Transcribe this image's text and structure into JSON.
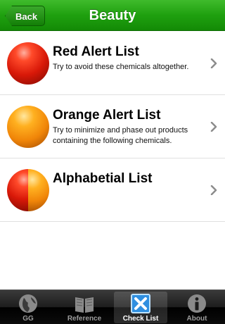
{
  "nav": {
    "back_label": "Back",
    "title": "Beauty"
  },
  "list": {
    "items": [
      {
        "title": "Red Alert List",
        "subtitle": "Try to avoid these chemicals altogether.",
        "icon": "red-ball-icon"
      },
      {
        "title": "Orange Alert List",
        "subtitle": "Try to minimize and phase out products containing the following chemicals.",
        "icon": "orange-ball-icon"
      },
      {
        "title": "Alphabetial List",
        "subtitle": "",
        "icon": "red-orange-ball-icon"
      }
    ]
  },
  "tabs": [
    {
      "label": "GG",
      "icon": "globe-icon",
      "selected": false
    },
    {
      "label": "Reference",
      "icon": "book-icon",
      "selected": false
    },
    {
      "label": "Check List",
      "icon": "checkbox-x-icon",
      "selected": true
    },
    {
      "label": "About",
      "icon": "info-icon",
      "selected": false
    }
  ],
  "colors": {
    "nav_green": "#1fa00f",
    "alert_red": "#d81808",
    "alert_orange": "#f08508"
  }
}
